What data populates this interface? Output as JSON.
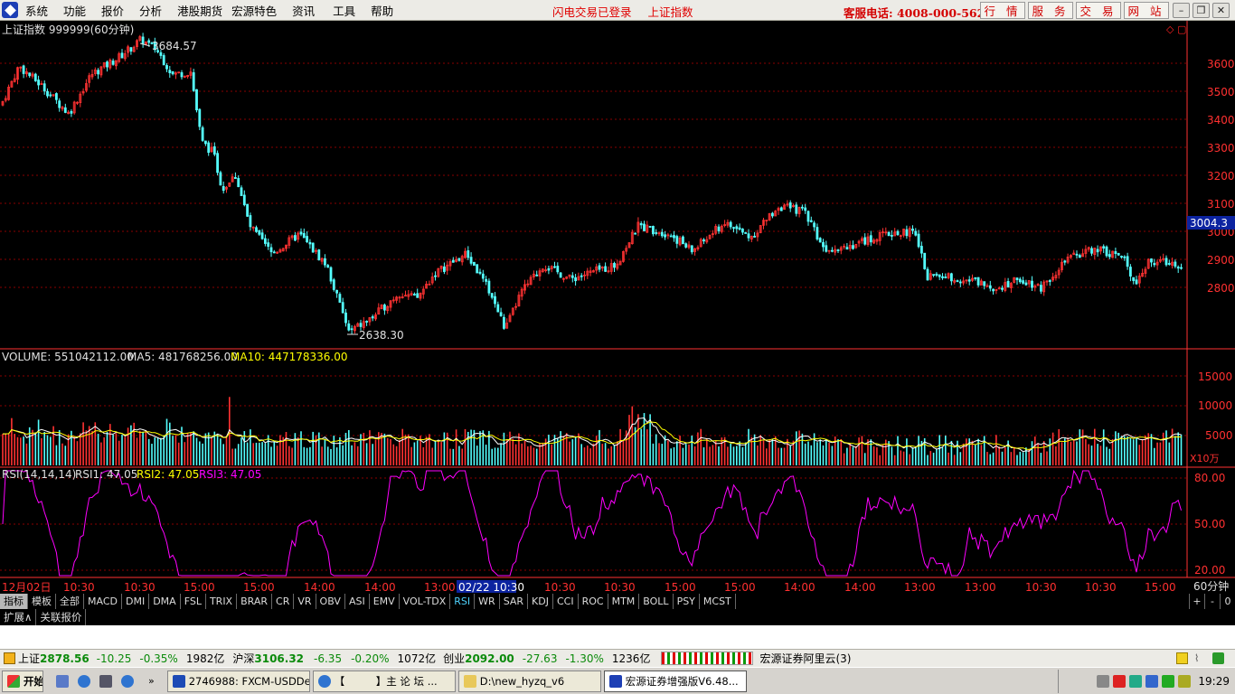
{
  "menu": {
    "items": [
      "系统",
      "功能",
      "报价",
      "分析",
      "港股期货",
      "宏源特色",
      "资讯",
      "工具",
      "帮助"
    ],
    "status_login": "闪电交易已登录",
    "status_index": "上证指数",
    "hotline": "客服电话: 4008-000-562",
    "quick_buttons": [
      "行 情",
      "服 务",
      "交 易",
      "网 站"
    ]
  },
  "main_chart": {
    "title": "上证指数 999999(60分钟)",
    "high_label": "3684.57",
    "low_label": "2638.30",
    "current_price_tag": "3004.3",
    "y_ticks": [
      "3600",
      "3500",
      "3400",
      "3300",
      "3200",
      "3100",
      "3000",
      "2900",
      "2800"
    ]
  },
  "volume_panel": {
    "label_volume": "VOLUME: 551042112.00",
    "label_ma5": "MA5: 481768256.00",
    "label_ma10": "MA10: 447178336.00",
    "y_ticks": [
      "15000",
      "10000",
      "5000"
    ],
    "unit": "X10万"
  },
  "rsi_panel": {
    "label_main": "RSI(14,14,14)",
    "label_rsi1": "RSI1: 47.05",
    "label_rsi2": "RSI2: 47.05",
    "label_rsi3": "RSI3: 47.05",
    "y_ticks": [
      "80.00",
      "50.00",
      "20.00"
    ]
  },
  "time_axis": {
    "labels": [
      "12月02日",
      "10:30",
      "10:30",
      "15:00",
      "15:00",
      "14:00",
      "14:00",
      "13:00",
      "02/22 10:30",
      "10:30",
      "10:30",
      "15:00",
      "15:00",
      "14:00",
      "14:00",
      "13:00",
      "13:00",
      "10:30",
      "10:30",
      "15:00"
    ],
    "period": "60分钟"
  },
  "indicator_tabs": [
    "指标",
    "模板",
    "全部",
    "MACD",
    "DMI",
    "DMA",
    "FSL",
    "TRIX",
    "BRAR",
    "CR",
    "VR",
    "OBV",
    "ASI",
    "EMV",
    "VOL-TDX",
    "RSI",
    "WR",
    "SAR",
    "KDJ",
    "CCI",
    "ROC",
    "MTM",
    "BOLL",
    "PSY",
    "MCST"
  ],
  "tab_controls": [
    "+",
    "-",
    "0"
  ],
  "sub_tabs": [
    "扩展∧",
    "关联报价"
  ],
  "status_bar": {
    "sh_label": "上证",
    "sh_price": "2878.56",
    "sh_change": "-10.25",
    "sh_pct": "-0.35%",
    "sh_vol": "1982亿",
    "hs_label": "沪深",
    "hs_price": "3106.32",
    "hs_change": "-6.35",
    "hs_pct": "-0.20%",
    "hs_vol": "1072亿",
    "cy_label": "创业",
    "cy_price": "2092.00",
    "cy_change": "-27.63",
    "cy_pct": "-1.30%",
    "cy_vol": "1236亿",
    "server": "宏源证券阿里云(3)"
  },
  "taskbar": {
    "start": "开始",
    "tasks": [
      "2746988: FXCM-USDDe...",
      "【　　　】主 论 坛 ...",
      "D:\\new_hyzq_v6",
      "宏源证券增强版V6.48..."
    ],
    "clock": "19:29"
  },
  "colors": {
    "up": "#ff3232",
    "down": "#54ffff",
    "ma5": "#ffffff",
    "ma10": "#ffff00",
    "rsi": "#ff00ff",
    "grid": "#8a0000"
  }
}
